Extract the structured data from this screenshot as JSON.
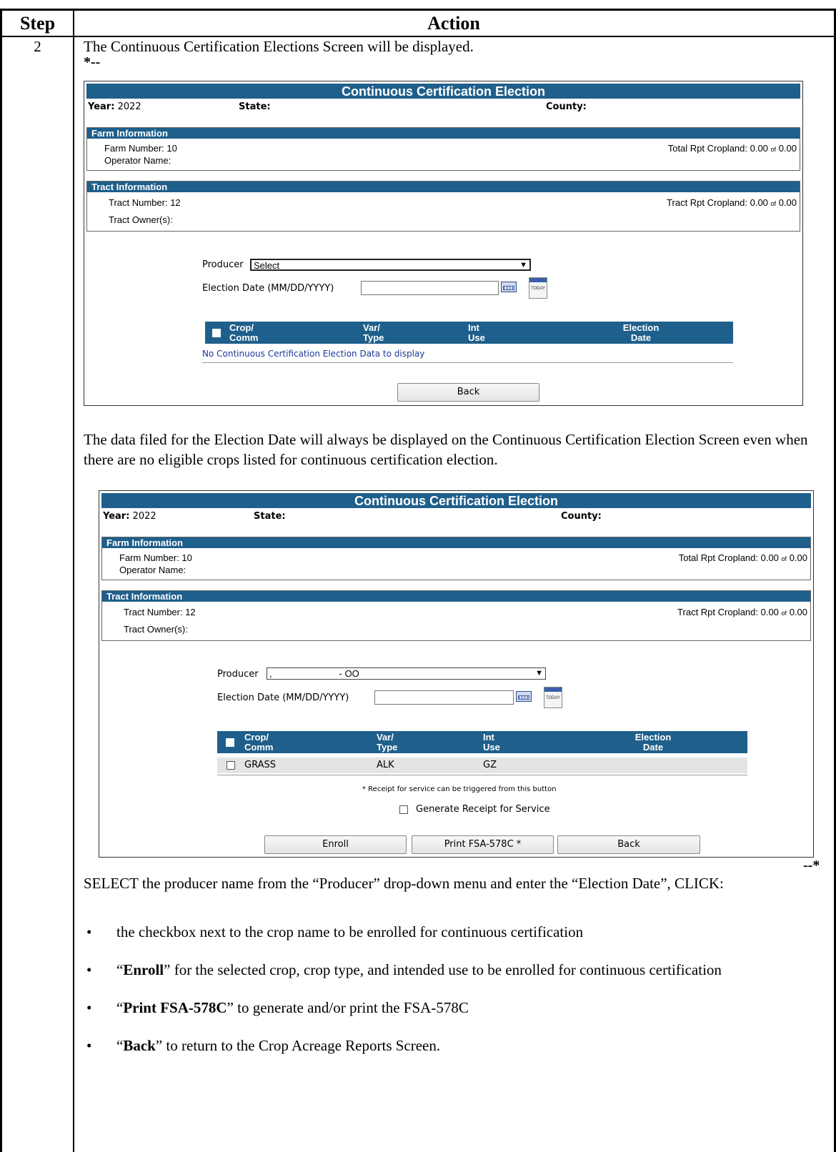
{
  "header": {
    "step": "Step",
    "action": "Action"
  },
  "step_number": "2",
  "intro": "The Continuous Certification Elections Screen will be displayed.",
  "marker_start": "*--",
  "marker_end": "--*",
  "screen1": {
    "title": "Continuous Certification Election",
    "year_label": "Year:",
    "year_value": "2022",
    "state_label": "State:",
    "county_label": "County:",
    "farm_header": "Farm Information",
    "farm_number": "Farm Number: 10",
    "operator_name": "Operator Name:",
    "total_rpt_label": "Total Rpt Cropland: 0.00",
    "total_rpt_of": "of",
    "total_rpt_total": "0.00",
    "tract_header": "Tract Information",
    "tract_number": "Tract Number: 12",
    "tract_owners": "Tract Owner(s):",
    "tract_rpt_label": "Tract Rpt Cropland: 0.00",
    "tract_rpt_of": "of",
    "tract_rpt_total": "0.00",
    "producer_label": "Producer",
    "producer_value": "Select",
    "election_date_label": "Election Date (MM/DD/YYYY)",
    "today_icon": "TODAY",
    "grid": {
      "col_crop": [
        "Crop/",
        "Comm"
      ],
      "col_var": [
        "Var/",
        "Type"
      ],
      "col_int": [
        "Int",
        "Use"
      ],
      "col_date": [
        "Election",
        "Date"
      ]
    },
    "no_data": "No Continuous Certification Election Data to display",
    "back_button": "Back"
  },
  "middle_text": "The data filed for the Election Date will always be displayed on the Continuous Certification Election Screen even when there are no eligible crops listed for continuous certification election.",
  "screen2": {
    "title": "Continuous Certification Election",
    "year_label": "Year:",
    "year_value": "2022",
    "state_label": "State:",
    "county_label": "County:",
    "farm_header": "Farm Information",
    "farm_number": "Farm Number: 10",
    "operator_name": "Operator Name:",
    "total_rpt_label": "Total Rpt Cropland: 0.00",
    "total_rpt_of": "of",
    "total_rpt_total": "0.00",
    "tract_header": "Tract Information",
    "tract_number": "Tract Number: 12",
    "tract_owners": "Tract Owner(s):",
    "tract_rpt_label": "Tract Rpt Cropland: 0.00",
    "tract_rpt_of": "of",
    "tract_rpt_total": "0.00",
    "producer_label": "Producer",
    "producer_value": ",                          - OO",
    "election_date_label": "Election Date (MM/DD/YYYY)",
    "today_icon": "TODAY",
    "grid": {
      "col_crop": [
        "Crop/",
        "Comm"
      ],
      "col_var": [
        "Var/",
        "Type"
      ],
      "col_int": [
        "Int",
        "Use"
      ],
      "col_date": [
        "Election",
        "Date"
      ]
    },
    "row": {
      "crop": "GRASS",
      "type": "ALK",
      "use": "GZ",
      "date": ""
    },
    "receipt_note": "* Receipt for service can be triggered from this button",
    "generate_receipt": "Generate Receipt for Service",
    "enroll_button": "Enroll",
    "print_button": "Print FSA-578C *",
    "back_button": "Back"
  },
  "instruction": "SELECT the producer name from the “Producer” drop-down menu and enter the “Election Date”, CLICK:",
  "bullets": [
    {
      "bold": "",
      "pre": "",
      "text": "the checkbox next to the crop name to be enrolled for continuous certification"
    },
    {
      "pre": "“",
      "bold": "Enroll",
      "text": "” for the selected crop, crop type, and intended use to be enrolled for continuous certification"
    },
    {
      "pre": "“",
      "bold": "Print FSA-578C",
      "text": "” to generate and/or print the FSA-578C"
    },
    {
      "pre": "“",
      "bold": "Back",
      "text": "” to return to the Crop Acreage Reports Screen."
    }
  ]
}
